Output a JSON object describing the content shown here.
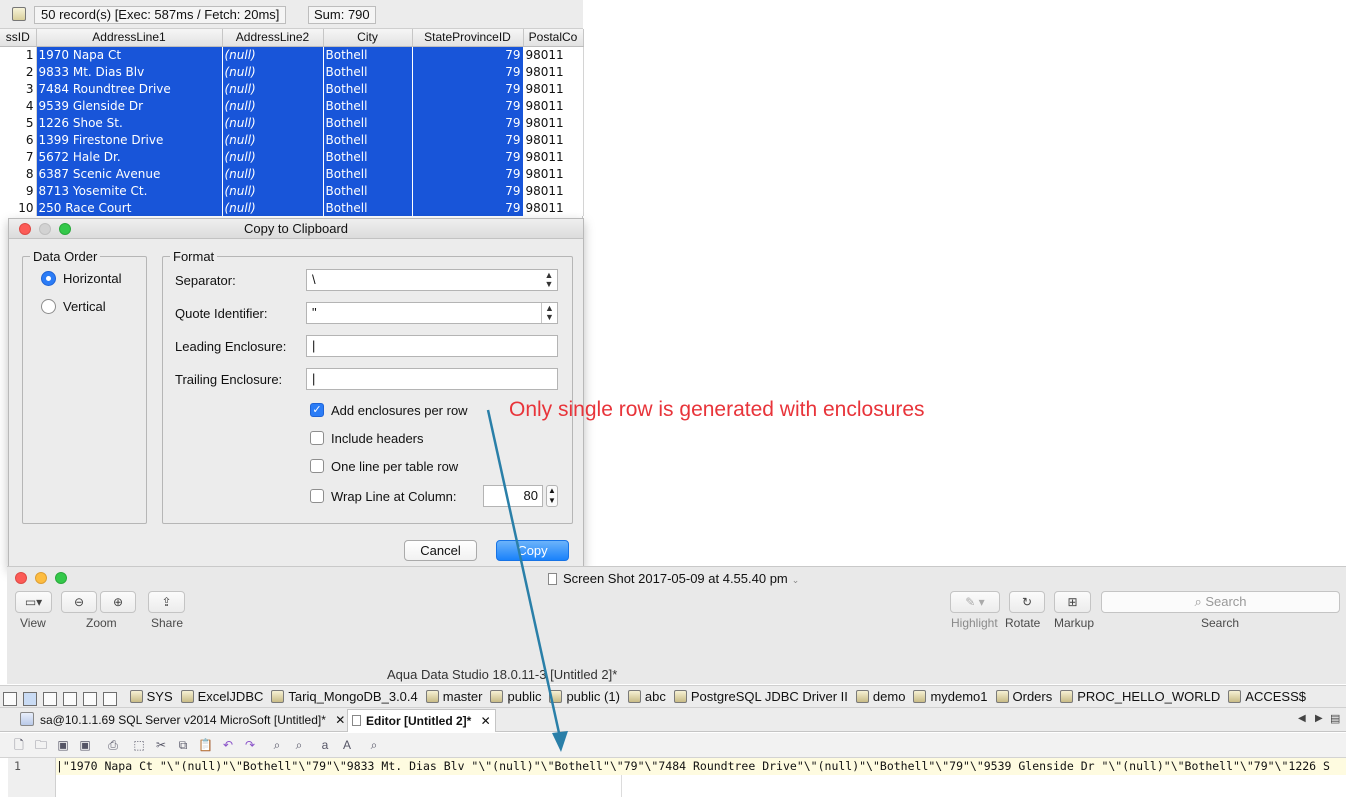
{
  "grid": {
    "status": "50 record(s) [Exec: 587ms / Fetch: 20ms]",
    "sum": "Sum: 790",
    "columns": [
      "ssID",
      "AddressLine1",
      "AddressLine2",
      "City",
      "StateProvinceID",
      "PostalCo"
    ],
    "rows": [
      [
        "1",
        "1970 Napa Ct",
        "(null)",
        "Bothell",
        "79",
        "98011"
      ],
      [
        "2",
        "9833 Mt. Dias Blv",
        "(null)",
        "Bothell",
        "79",
        "98011"
      ],
      [
        "3",
        "7484 Roundtree Drive",
        "(null)",
        "Bothell",
        "79",
        "98011"
      ],
      [
        "4",
        "9539 Glenside Dr",
        "(null)",
        "Bothell",
        "79",
        "98011"
      ],
      [
        "5",
        "1226 Shoe St.",
        "(null)",
        "Bothell",
        "79",
        "98011"
      ],
      [
        "6",
        "1399 Firestone Drive",
        "(null)",
        "Bothell",
        "79",
        "98011"
      ],
      [
        "7",
        "5672 Hale Dr.",
        "(null)",
        "Bothell",
        "79",
        "98011"
      ],
      [
        "8",
        "6387 Scenic Avenue",
        "(null)",
        "Bothell",
        "79",
        "98011"
      ],
      [
        "9",
        "8713 Yosemite Ct.",
        "(null)",
        "Bothell",
        "79",
        "98011"
      ],
      [
        "10",
        "250 Race Court",
        "(null)",
        "Bothell",
        "79",
        "98011"
      ]
    ]
  },
  "dialog": {
    "title": "Copy to Clipboard",
    "data_order": {
      "legend": "Data Order",
      "options": [
        "Horizontal",
        "Vertical"
      ],
      "selected": "Horizontal"
    },
    "format": {
      "legend": "Format",
      "separator_label": "Separator:",
      "separator_value": "\\",
      "quote_label": "Quote Identifier:",
      "quote_value": "\"",
      "leading_label": "Leading Enclosure:",
      "leading_value": "|",
      "trailing_label": "Trailing Enclosure:",
      "trailing_value": "|",
      "add_enclosures_label": "Add enclosures per row",
      "add_enclosures_checked": true,
      "include_headers_label": "Include headers",
      "include_headers_checked": false,
      "one_line_label": "One line per table row",
      "one_line_checked": false,
      "wrap_label": "Wrap Line at Column:",
      "wrap_checked": false,
      "wrap_value": "80"
    },
    "cancel_label": "Cancel",
    "copy_label": "Copy"
  },
  "annotation": {
    "text": "Only single row is generated with enclosures",
    "color": "#e8343a",
    "arrow_color": "#2a7fa8"
  },
  "preview": {
    "title": "Screen Shot 2017-05-09 at 4.55.40 pm",
    "toolbar": {
      "view": "View",
      "zoom": "Zoom",
      "share": "Share",
      "highlight": "Highlight",
      "rotate": "Rotate",
      "markup": "Markup",
      "search_placeholder": "Search",
      "search_caption": "Search"
    }
  },
  "app": {
    "title": "Aqua Data Studio 18.0.11-3 [Untitled 2]*",
    "bookmarks": [
      "SYS",
      "ExcelJDBC",
      "Tariq_MongoDB_3.0.4",
      "master",
      "public",
      "public (1)",
      "abc",
      "PostgreSQL JDBC Driver II",
      "demo",
      "mydemo1",
      "Orders",
      "PROC_HELLO_WORLD",
      "ACCESS$"
    ],
    "tabs": [
      "sa@10.1.1.69 SQL Server v2014 MicroSoft [Untitled]*",
      "Editor [Untitled 2]*"
    ],
    "editor_line_number": "1",
    "editor_line": "|\"1970 Napa Ct \"\\\"(null)\"\\\"Bothell\"\\\"79\"\\\"9833 Mt. Dias Blv \"\\\"(null)\"\\\"Bothell\"\\\"79\"\\\"7484 Roundtree Drive\"\\\"(null)\"\\\"Bothell\"\\\"79\"\\\"9539 Glenside Dr \"\\\"(null)\"\\\"Bothell\"\\\"79\"\\\"1226 S"
  }
}
